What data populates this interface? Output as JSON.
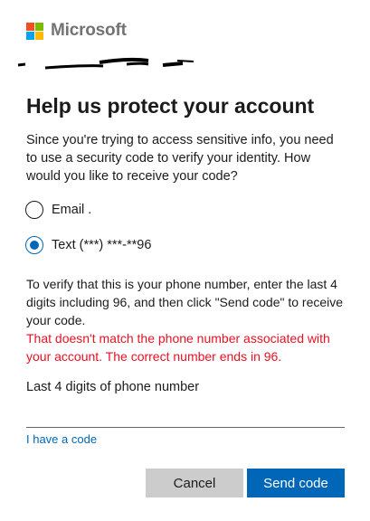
{
  "brand": {
    "name": "Microsoft",
    "logo_colors": [
      "#f25022",
      "#7fba00",
      "#00a4ef",
      "#ffb900"
    ]
  },
  "page": {
    "title": "Help us protect your account",
    "description": "Since you're trying to access sensitive info, you need to use a security code to verify your identity. How would you like to receive your code?"
  },
  "options": {
    "email": {
      "label": "Email .",
      "selected": false
    },
    "text": {
      "label": "Text (***) ***-**96",
      "selected": true
    }
  },
  "verify": {
    "instructions": "To verify that this is your phone number, enter the last 4 digits including 96, and then click \"Send code\" to receive your code.",
    "error": "That doesn't match the phone number associated with your account. The correct number ends in 96."
  },
  "field": {
    "label": "Last 4 digits of phone number",
    "value": ""
  },
  "links": {
    "have_code": "I have a code"
  },
  "buttons": {
    "cancel": "Cancel",
    "send": "Send code"
  },
  "colors": {
    "accent": "#0067b8",
    "error": "#e81123"
  }
}
